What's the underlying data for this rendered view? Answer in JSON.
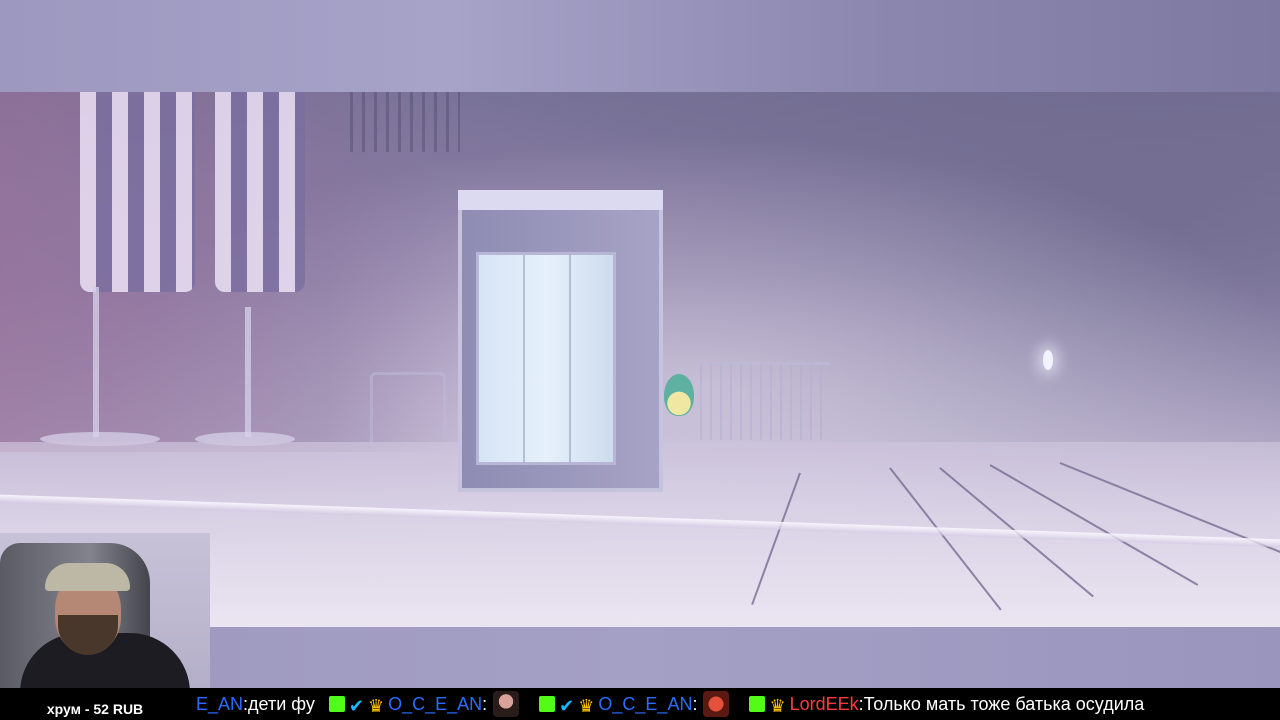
{
  "stream": {
    "donation_label": "хрум - 52 RUB"
  },
  "chat": {
    "messages": [
      {
        "user": "E_AN",
        "separator": ":",
        "text": " дети фу",
        "user_color": "#2b6cff"
      },
      {
        "user": "O_C_E_AN",
        "separator": ":",
        "text": "",
        "user_color": "#2b6cff",
        "emote": "woman-emote"
      },
      {
        "user": "O_C_E_AN",
        "separator": ":",
        "text": "",
        "user_color": "#2b6cff",
        "emote": "face-emote"
      },
      {
        "user": "LordEEk",
        "separator": ":",
        "text": " Только мать тоже батька осудила",
        "user_color": "#ff3b3b"
      }
    ]
  },
  "colors": {
    "chat_background": "#000000",
    "kick_badge": "#53fc18",
    "verified_badge": "#19b8ff",
    "crown_badge": "#ffc400"
  },
  "icons": {
    "kick_badge": "kick-icon",
    "verified_badge": "checkmark-icon",
    "crown_badge": "crown-icon"
  }
}
